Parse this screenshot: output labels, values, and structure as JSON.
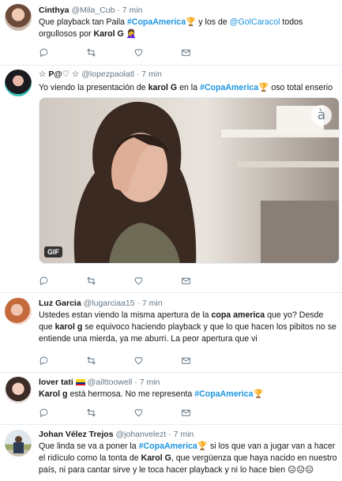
{
  "tweets": [
    {
      "name": "Cinthya",
      "handle": "@Mila_Cub",
      "dot": "·",
      "time": "7 min",
      "text_parts": [
        "Que playback tan Paila ",
        "#CopaAmerica",
        " y los de ",
        "@GolCaracol",
        " todos orgullosos por ",
        "Karol G"
      ]
    },
    {
      "name": "☆ P@♡ ☆",
      "handle": "@lopezpaolatl",
      "dot": "·",
      "time": "7 min",
      "text_parts": [
        "Yo viendo la presentación de ",
        "karol G",
        " en la ",
        "#CopaAmerica",
        " oso total enserio"
      ],
      "media_badge": "GIF",
      "media_watermark": "à"
    },
    {
      "name": "Luz Garcia",
      "handle": "@lugarciaa15",
      "dot": "·",
      "time": "7 min",
      "text_parts": [
        "Ustedes estan viendo la misma apertura de la ",
        "copa america",
        " que yo? Desde que ",
        "karol g",
        " se equivoco haciendo playback y que lo que hacen los pibitos no se entiende una mierda, ya me aburri. La peor apertura que vi"
      ]
    },
    {
      "name": "lover tati",
      "handle": "@ailttoowell",
      "dot": "·",
      "time": "7 min",
      "text_parts": [
        "Karol g",
        " está hermosa. No me representa ",
        "#CopaAmerica"
      ]
    },
    {
      "name": "Johan Vélez Trejos",
      "handle": "@johanvelezt",
      "dot": "·",
      "time": "7 min",
      "text_parts": [
        "Que linda se va a poner la ",
        "#CopaAmerica",
        " si los que van a jugar van a hacer el ridículo como la tonta de ",
        "Karol G",
        ", que vergüenza que haya nacido en nuestro país, ni para cantar sirve y le toca hacer playback y ni lo hace bien "
      ]
    }
  ],
  "icons": {
    "reply": "reply-icon",
    "retweet": "retweet-icon",
    "like": "heart-icon",
    "dm": "envelope-icon"
  },
  "colors": {
    "link": "#1b95e0",
    "muted": "#657786",
    "border": "#e6ecf0"
  }
}
